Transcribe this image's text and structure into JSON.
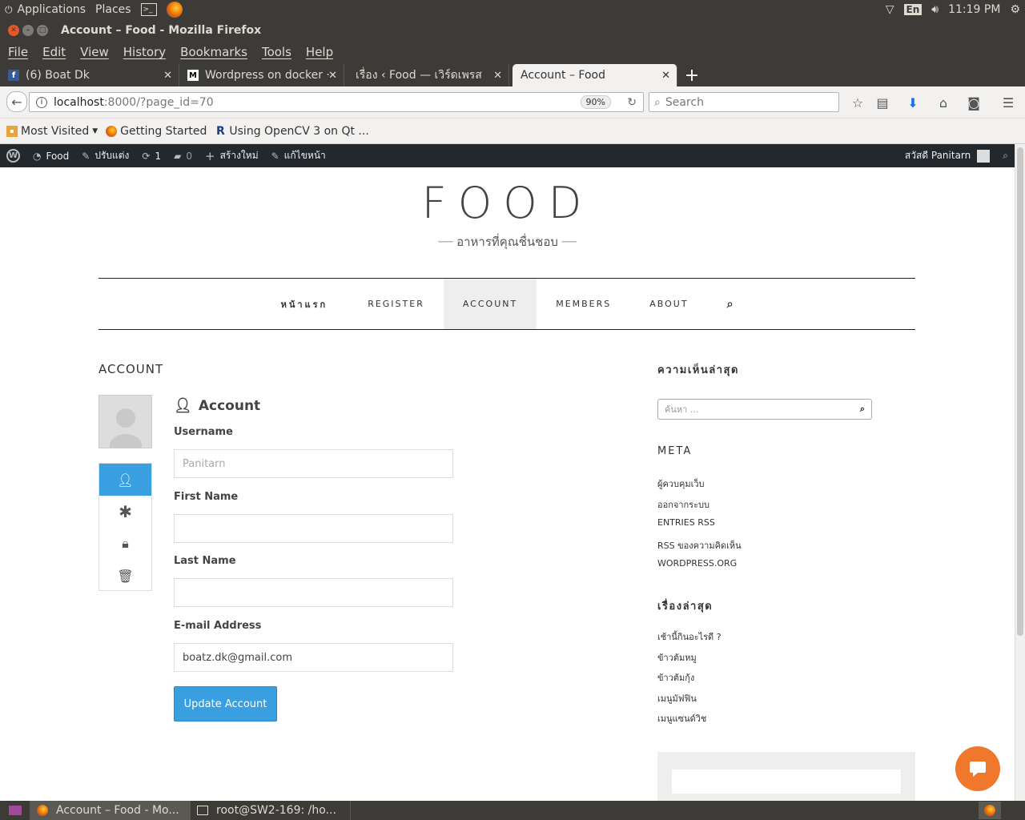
{
  "panel": {
    "applications": "Applications",
    "places": "Places",
    "lang": "En",
    "time": "11:19 PM"
  },
  "window": {
    "title": "Account – Food - Mozilla Firefox"
  },
  "menu": [
    "File",
    "Edit",
    "View",
    "History",
    "Bookmarks",
    "Tools",
    "Help"
  ],
  "tabs": [
    {
      "label": "(6) Boat Dk",
      "icon": "facebook-icon"
    },
    {
      "label": "Wordpress on docker ·",
      "icon": "medium-icon"
    },
    {
      "label": "เรื่อง ‹ Food — เวิร์ดเพรส",
      "icon": "none"
    },
    {
      "label": "Account – Food",
      "icon": "none"
    }
  ],
  "urlbar": {
    "host": "localhost",
    "path": ":8000/?page_id=70",
    "zoom": "90%"
  },
  "search": {
    "placeholder": "Search"
  },
  "bookmarks": [
    "Most Visited",
    "Getting Started",
    "Using OpenCV 3 on Qt ..."
  ],
  "wpbar": {
    "site": "Food",
    "customize": "ปรับแต่ง",
    "updates": "1",
    "comments": "0",
    "new": "สร้างใหม่",
    "edit": "แก้ไขหน้า",
    "howdy": "สวัสดี Panitarn"
  },
  "site": {
    "title": "FOOD",
    "tagline": "อาหารที่คุณชื่นชอบ"
  },
  "nav": [
    "หน้าแรก",
    "REGISTER",
    "ACCOUNT",
    "MEMBERS",
    "ABOUT"
  ],
  "page": {
    "title": "ACCOUNT"
  },
  "form": {
    "heading": "Account",
    "username_label": "Username",
    "username_value": "Panitarn",
    "first_label": "First Name",
    "first_value": "",
    "last_label": "Last Name",
    "last_value": "",
    "email_label": "E-mail Address",
    "email_value": "boatz.dk@gmail.com",
    "submit": "Update Account"
  },
  "sidebar": {
    "recent_comments": "ความเห็นล่าสุด",
    "search_placeholder": "ค้นหา …",
    "meta_title": "META",
    "meta_links": [
      "ผู้ควบคุมเว็บ",
      "ออกจากระบบ",
      "ENTRIES RSS",
      "RSS ของความคิดเห็น",
      "WORDPRESS.ORG"
    ],
    "recent_posts_title": "เรื่องล่าสุด",
    "recent_posts": [
      "เช้านี้กินอะไรดี ?",
      "ข้าวต้มหมู",
      "ข้าวต้มกุ้ง",
      "เมนูมัฟฟิน",
      "เมนูแซนด์วิช"
    ]
  },
  "taskbar": [
    "Account – Food - Mo...",
    "root@SW2-169: /ho..."
  ],
  "colors": {
    "accent": "#3a9fe0",
    "chat": "#f0782d",
    "wpbar": "#23282d",
    "chrome": "#3c3b37"
  }
}
